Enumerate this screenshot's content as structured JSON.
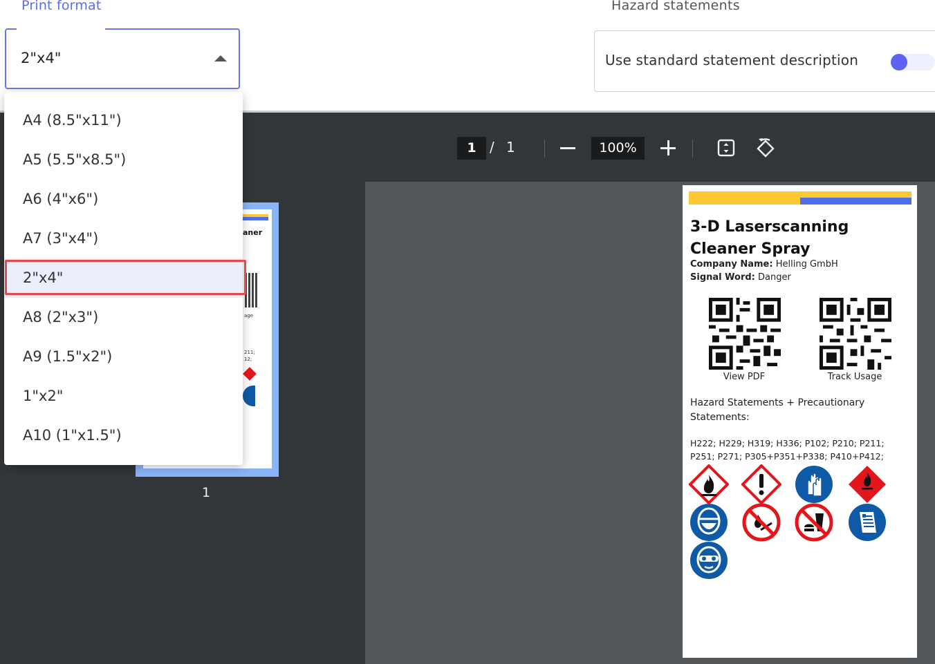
{
  "settings": {
    "print_format_label": "Print format",
    "print_format_value": "2\"x4\"",
    "hazard_label": "Hazard statements",
    "hazard_toggle_text": "Use standard statement description"
  },
  "dropdown": {
    "options": [
      "A4 (8.5\"x11\")",
      "A5 (5.5\"x8.5\")",
      "A6 (4\"x6\")",
      "A7 (3\"x4\")",
      "2\"x4\"",
      "A8 (2\"x3\")",
      "A9 (1.5\"x2\")",
      "1\"x2\"",
      "A10 (1\"x1.5\")"
    ],
    "selected": "2\"x4\""
  },
  "viewer": {
    "current_page": "1",
    "separator": "/",
    "total_pages": "1",
    "zoom": "100%",
    "thumbnail_number": "1",
    "thumbnail_fragments": {
      "title_tail": "aner",
      "usage_tail": "age",
      "codes_1": "211;",
      "codes_2": "12;"
    }
  },
  "label": {
    "title": "3-D Laserscanning Cleaner Spray",
    "company_key": "Company Name:",
    "company_value": "Helling GmbH",
    "signal_key": "Signal Word:",
    "signal_value": "Danger",
    "qr_left_caption": "View PDF",
    "qr_right_caption": "Track Usage",
    "hazard_heading": "Hazard Statements + Precautionary Statements:",
    "hazard_codes": "H222; H229; H319; H336; P102; P210; P211; P251; P271; P305+P351+P338; P410+P412;",
    "pictograms": [
      "flame-pictogram",
      "exclamation-pictogram",
      "gloves-pictogram",
      "flammable-diamond-pictogram",
      "respirator-pictogram",
      "no-open-flame-pictogram",
      "no-eating-drinking-pictogram",
      "read-manual-pictogram",
      "safety-goggles-pictogram"
    ]
  },
  "colors": {
    "accent": "#5b6cf0",
    "highlight": "#e94848",
    "label_yellow": "#fcc934",
    "label_blue": "#4f6fe8",
    "mandatory_blue": "#0f5aa6",
    "hazard_red": "#e4161b"
  }
}
